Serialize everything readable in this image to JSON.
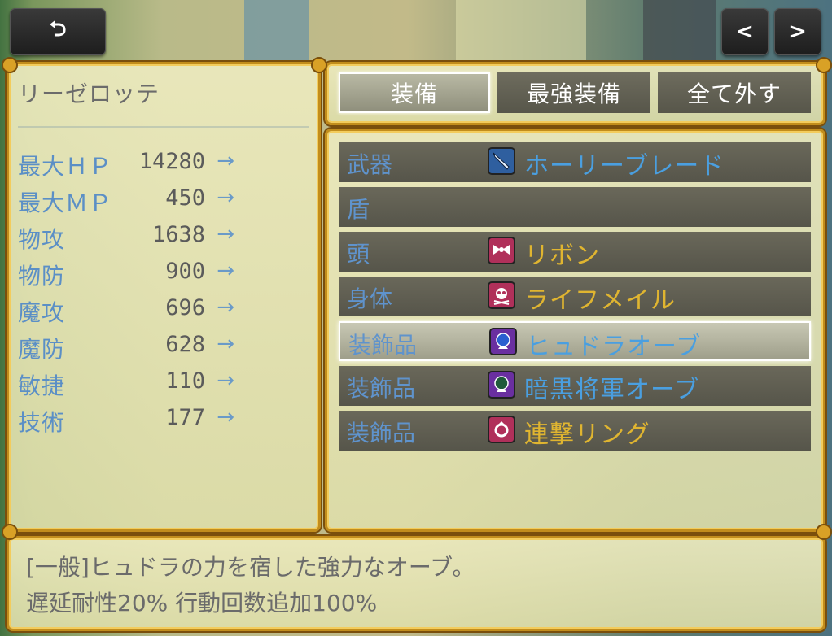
{
  "top_bar": {
    "back_glyph": "⮌",
    "prev_glyph": "<",
    "next_glyph": ">"
  },
  "actor": {
    "name": "リーゼロッテ",
    "stats": [
      {
        "label": "最大ＨＰ",
        "value": "14280",
        "arrow": "→"
      },
      {
        "label": "最大ＭＰ",
        "value": "450",
        "arrow": "→"
      },
      {
        "label": "物攻",
        "value": "1638",
        "arrow": "→"
      },
      {
        "label": "物防",
        "value": "900",
        "arrow": "→"
      },
      {
        "label": "魔攻",
        "value": "696",
        "arrow": "→"
      },
      {
        "label": "魔防",
        "value": "628",
        "arrow": "→"
      },
      {
        "label": "敏捷",
        "value": "110",
        "arrow": "→"
      },
      {
        "label": "技術",
        "value": "177",
        "arrow": "→"
      }
    ]
  },
  "commands": {
    "equip": "装備",
    "optimize": "最強装備",
    "clear": "全て外す"
  },
  "slots": [
    {
      "type": "武器",
      "item": "ホーリーブレード",
      "icon": "sword-icon",
      "item_color": "#4a9fe0",
      "icon_bg": "#2f5f9f"
    },
    {
      "type": "盾",
      "item": "",
      "icon": "",
      "item_color": "#4a9fe0",
      "icon_bg": ""
    },
    {
      "type": "頭",
      "item": "リボン",
      "icon": "ribbon-icon",
      "item_color": "#e0b530",
      "icon_bg": "#b0305a"
    },
    {
      "type": "身体",
      "item": "ライフメイル",
      "icon": "skull-armor-icon",
      "item_color": "#e0b530",
      "icon_bg": "#b0305a"
    },
    {
      "type": "装飾品",
      "item": "ヒュドラオーブ",
      "icon": "blue-orb-icon",
      "item_color": "#4a9fe0",
      "icon_bg": "#6a2fa0"
    },
    {
      "type": "装飾品",
      "item": "暗黒将軍オーブ",
      "icon": "green-orb-icon",
      "item_color": "#4a9fe0",
      "icon_bg": "#6a2fa0"
    },
    {
      "type": "装飾品",
      "item": "連撃リング",
      "icon": "ring-icon",
      "item_color": "#e0b530",
      "icon_bg": "#b0305a"
    }
  ],
  "help": {
    "line1": "[一般]ヒュドラの力を宿した強力なオーブ。",
    "line2": "遅延耐性20% 行動回数追加100%"
  },
  "colors": {
    "frame_gold": "#c28d1c",
    "stat_label_blue": "#5b8fc6",
    "slot_type_blue": "#5f93cc"
  }
}
